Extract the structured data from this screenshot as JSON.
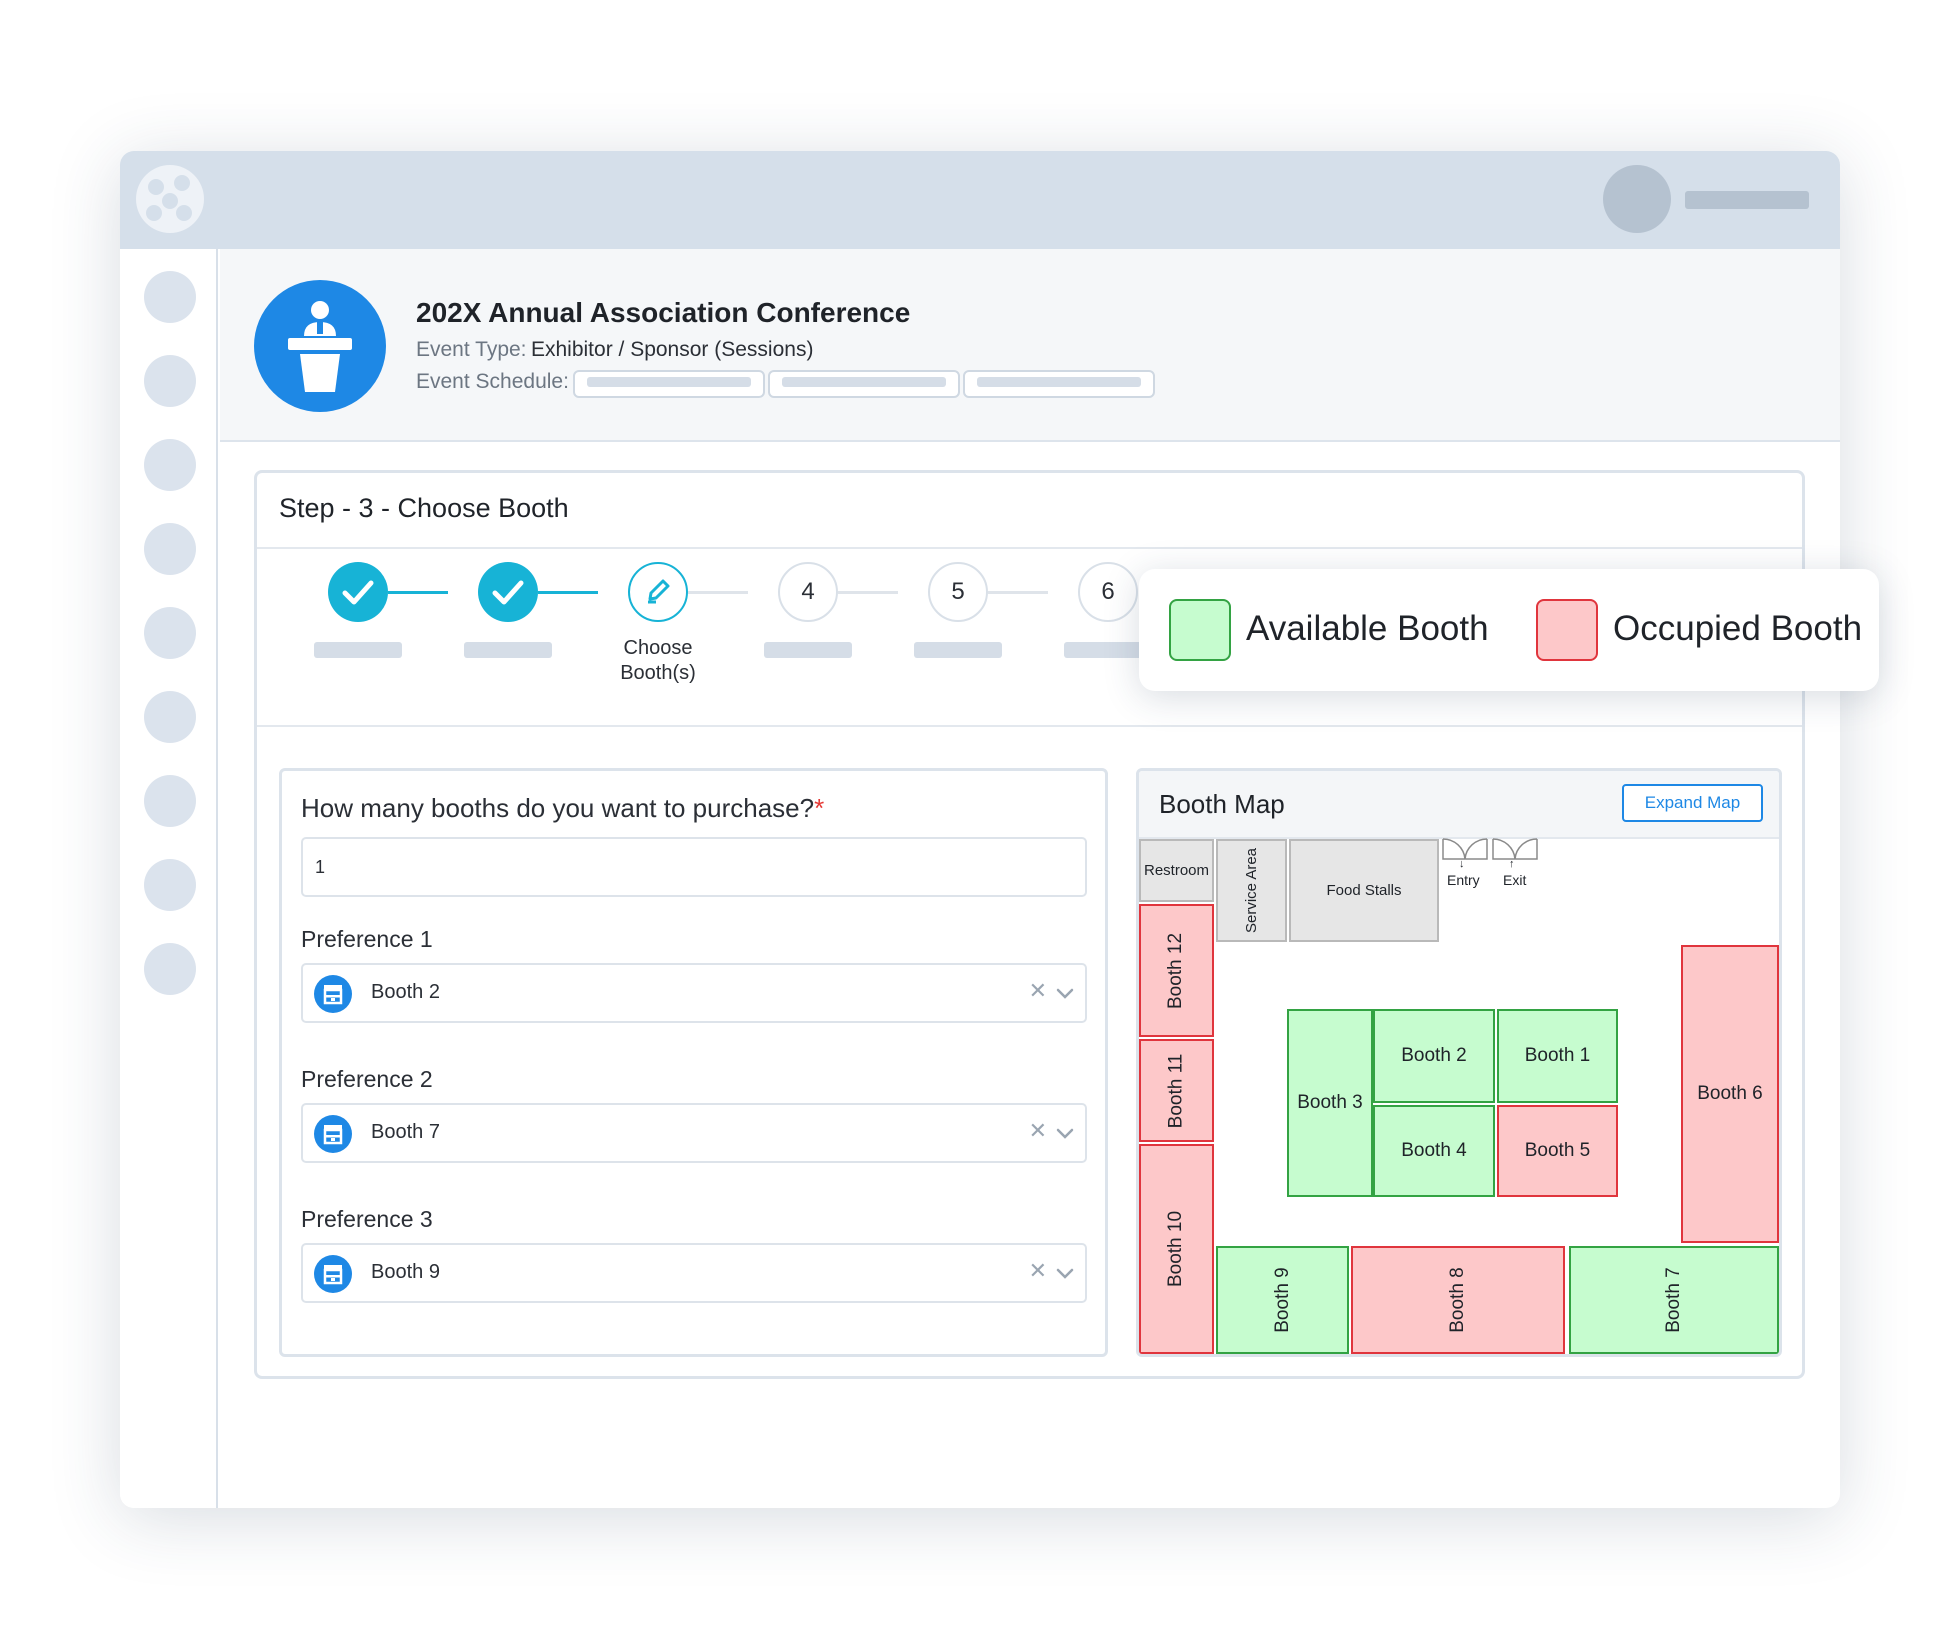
{
  "event": {
    "title": "202X Annual Association Conference",
    "type_label": "Event Type:",
    "type_value": "Exhibitor / Sponsor (Sessions)",
    "schedule_label": "Event Schedule:"
  },
  "step": {
    "title": "Step - 3 - Choose Booth",
    "steps": [
      {
        "state": "done",
        "number": ""
      },
      {
        "state": "done",
        "number": ""
      },
      {
        "state": "current",
        "number": "",
        "label_line1": "Choose",
        "label_line2": "Booth(s)"
      },
      {
        "state": "todo",
        "number": "4"
      },
      {
        "state": "todo",
        "number": "5"
      },
      {
        "state": "todo",
        "number": "6"
      }
    ]
  },
  "form": {
    "question": "How many booths do you want to purchase?",
    "required_mark": "*",
    "quantity": "1",
    "preferences": [
      {
        "label": "Preference 1",
        "value": "Booth 2"
      },
      {
        "label": "Preference 2",
        "value": "Booth 7"
      },
      {
        "label": "Preference 3",
        "value": "Booth 9"
      }
    ],
    "clear_glyph": "✕"
  },
  "map": {
    "title": "Booth Map",
    "expand_label": "Expand Map",
    "facilities": {
      "restroom": "Restroom",
      "service_area": "Service Area",
      "food_stalls": "Food Stalls",
      "entry": "Entry",
      "exit": "Exit",
      "entry_arrow": "↓",
      "exit_arrow": "↑"
    },
    "booths": {
      "b1": {
        "label": "Booth 1",
        "status": "available"
      },
      "b2": {
        "label": "Booth 2",
        "status": "available"
      },
      "b3": {
        "label": "Booth 3",
        "status": "available"
      },
      "b4": {
        "label": "Booth 4",
        "status": "available"
      },
      "b5": {
        "label": "Booth 5",
        "status": "occupied"
      },
      "b6": {
        "label": "Booth 6",
        "status": "occupied"
      },
      "b7": {
        "label": "Booth 7",
        "status": "available"
      },
      "b8": {
        "label": "Booth 8",
        "status": "occupied"
      },
      "b9": {
        "label": "Booth 9",
        "status": "available"
      },
      "b10": {
        "label": "Booth 10",
        "status": "occupied"
      },
      "b11": {
        "label": "Booth 11",
        "status": "occupied"
      },
      "b12": {
        "label": "Booth 12",
        "status": "occupied"
      }
    }
  },
  "legend": {
    "available": "Available Booth",
    "occupied": "Occupied Booth"
  },
  "colors": {
    "accent": "#1e88e5",
    "step_done": "#17b3d6",
    "available_fill": "#c6fccf",
    "available_border": "#33a343",
    "occupied_fill": "#fdc8c9",
    "occupied_border": "#e0353d"
  },
  "icons": {
    "logo": "app-logo-icon",
    "event": "podium-speaker-icon",
    "step_done": "checkmark-icon",
    "step_current": "pencil-icon",
    "booth": "booth-stand-icon",
    "clear": "close-icon",
    "dropdown": "chevron-down-icon"
  }
}
